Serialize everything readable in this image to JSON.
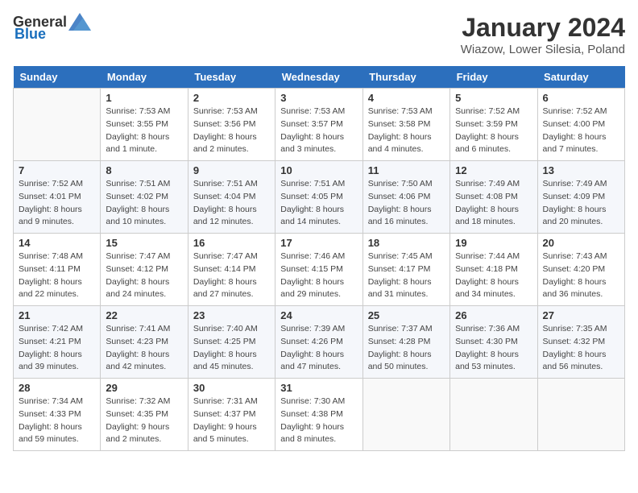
{
  "header": {
    "logo_general": "General",
    "logo_blue": "Blue",
    "month_year": "January 2024",
    "location": "Wiazow, Lower Silesia, Poland"
  },
  "weekdays": [
    "Sunday",
    "Monday",
    "Tuesday",
    "Wednesday",
    "Thursday",
    "Friday",
    "Saturday"
  ],
  "weeks": [
    [
      {
        "day": "",
        "sunrise": "",
        "sunset": "",
        "daylight": ""
      },
      {
        "day": "1",
        "sunrise": "Sunrise: 7:53 AM",
        "sunset": "Sunset: 3:55 PM",
        "daylight": "Daylight: 8 hours and 1 minute."
      },
      {
        "day": "2",
        "sunrise": "Sunrise: 7:53 AM",
        "sunset": "Sunset: 3:56 PM",
        "daylight": "Daylight: 8 hours and 2 minutes."
      },
      {
        "day": "3",
        "sunrise": "Sunrise: 7:53 AM",
        "sunset": "Sunset: 3:57 PM",
        "daylight": "Daylight: 8 hours and 3 minutes."
      },
      {
        "day": "4",
        "sunrise": "Sunrise: 7:53 AM",
        "sunset": "Sunset: 3:58 PM",
        "daylight": "Daylight: 8 hours and 4 minutes."
      },
      {
        "day": "5",
        "sunrise": "Sunrise: 7:52 AM",
        "sunset": "Sunset: 3:59 PM",
        "daylight": "Daylight: 8 hours and 6 minutes."
      },
      {
        "day": "6",
        "sunrise": "Sunrise: 7:52 AM",
        "sunset": "Sunset: 4:00 PM",
        "daylight": "Daylight: 8 hours and 7 minutes."
      }
    ],
    [
      {
        "day": "7",
        "sunrise": "Sunrise: 7:52 AM",
        "sunset": "Sunset: 4:01 PM",
        "daylight": "Daylight: 8 hours and 9 minutes."
      },
      {
        "day": "8",
        "sunrise": "Sunrise: 7:51 AM",
        "sunset": "Sunset: 4:02 PM",
        "daylight": "Daylight: 8 hours and 10 minutes."
      },
      {
        "day": "9",
        "sunrise": "Sunrise: 7:51 AM",
        "sunset": "Sunset: 4:04 PM",
        "daylight": "Daylight: 8 hours and 12 minutes."
      },
      {
        "day": "10",
        "sunrise": "Sunrise: 7:51 AM",
        "sunset": "Sunset: 4:05 PM",
        "daylight": "Daylight: 8 hours and 14 minutes."
      },
      {
        "day": "11",
        "sunrise": "Sunrise: 7:50 AM",
        "sunset": "Sunset: 4:06 PM",
        "daylight": "Daylight: 8 hours and 16 minutes."
      },
      {
        "day": "12",
        "sunrise": "Sunrise: 7:49 AM",
        "sunset": "Sunset: 4:08 PM",
        "daylight": "Daylight: 8 hours and 18 minutes."
      },
      {
        "day": "13",
        "sunrise": "Sunrise: 7:49 AM",
        "sunset": "Sunset: 4:09 PM",
        "daylight": "Daylight: 8 hours and 20 minutes."
      }
    ],
    [
      {
        "day": "14",
        "sunrise": "Sunrise: 7:48 AM",
        "sunset": "Sunset: 4:11 PM",
        "daylight": "Daylight: 8 hours and 22 minutes."
      },
      {
        "day": "15",
        "sunrise": "Sunrise: 7:47 AM",
        "sunset": "Sunset: 4:12 PM",
        "daylight": "Daylight: 8 hours and 24 minutes."
      },
      {
        "day": "16",
        "sunrise": "Sunrise: 7:47 AM",
        "sunset": "Sunset: 4:14 PM",
        "daylight": "Daylight: 8 hours and 27 minutes."
      },
      {
        "day": "17",
        "sunrise": "Sunrise: 7:46 AM",
        "sunset": "Sunset: 4:15 PM",
        "daylight": "Daylight: 8 hours and 29 minutes."
      },
      {
        "day": "18",
        "sunrise": "Sunrise: 7:45 AM",
        "sunset": "Sunset: 4:17 PM",
        "daylight": "Daylight: 8 hours and 31 minutes."
      },
      {
        "day": "19",
        "sunrise": "Sunrise: 7:44 AM",
        "sunset": "Sunset: 4:18 PM",
        "daylight": "Daylight: 8 hours and 34 minutes."
      },
      {
        "day": "20",
        "sunrise": "Sunrise: 7:43 AM",
        "sunset": "Sunset: 4:20 PM",
        "daylight": "Daylight: 8 hours and 36 minutes."
      }
    ],
    [
      {
        "day": "21",
        "sunrise": "Sunrise: 7:42 AM",
        "sunset": "Sunset: 4:21 PM",
        "daylight": "Daylight: 8 hours and 39 minutes."
      },
      {
        "day": "22",
        "sunrise": "Sunrise: 7:41 AM",
        "sunset": "Sunset: 4:23 PM",
        "daylight": "Daylight: 8 hours and 42 minutes."
      },
      {
        "day": "23",
        "sunrise": "Sunrise: 7:40 AM",
        "sunset": "Sunset: 4:25 PM",
        "daylight": "Daylight: 8 hours and 45 minutes."
      },
      {
        "day": "24",
        "sunrise": "Sunrise: 7:39 AM",
        "sunset": "Sunset: 4:26 PM",
        "daylight": "Daylight: 8 hours and 47 minutes."
      },
      {
        "day": "25",
        "sunrise": "Sunrise: 7:37 AM",
        "sunset": "Sunset: 4:28 PM",
        "daylight": "Daylight: 8 hours and 50 minutes."
      },
      {
        "day": "26",
        "sunrise": "Sunrise: 7:36 AM",
        "sunset": "Sunset: 4:30 PM",
        "daylight": "Daylight: 8 hours and 53 minutes."
      },
      {
        "day": "27",
        "sunrise": "Sunrise: 7:35 AM",
        "sunset": "Sunset: 4:32 PM",
        "daylight": "Daylight: 8 hours and 56 minutes."
      }
    ],
    [
      {
        "day": "28",
        "sunrise": "Sunrise: 7:34 AM",
        "sunset": "Sunset: 4:33 PM",
        "daylight": "Daylight: 8 hours and 59 minutes."
      },
      {
        "day": "29",
        "sunrise": "Sunrise: 7:32 AM",
        "sunset": "Sunset: 4:35 PM",
        "daylight": "Daylight: 9 hours and 2 minutes."
      },
      {
        "day": "30",
        "sunrise": "Sunrise: 7:31 AM",
        "sunset": "Sunset: 4:37 PM",
        "daylight": "Daylight: 9 hours and 5 minutes."
      },
      {
        "day": "31",
        "sunrise": "Sunrise: 7:30 AM",
        "sunset": "Sunset: 4:38 PM",
        "daylight": "Daylight: 9 hours and 8 minutes."
      },
      {
        "day": "",
        "sunrise": "",
        "sunset": "",
        "daylight": ""
      },
      {
        "day": "",
        "sunrise": "",
        "sunset": "",
        "daylight": ""
      },
      {
        "day": "",
        "sunrise": "",
        "sunset": "",
        "daylight": ""
      }
    ]
  ]
}
